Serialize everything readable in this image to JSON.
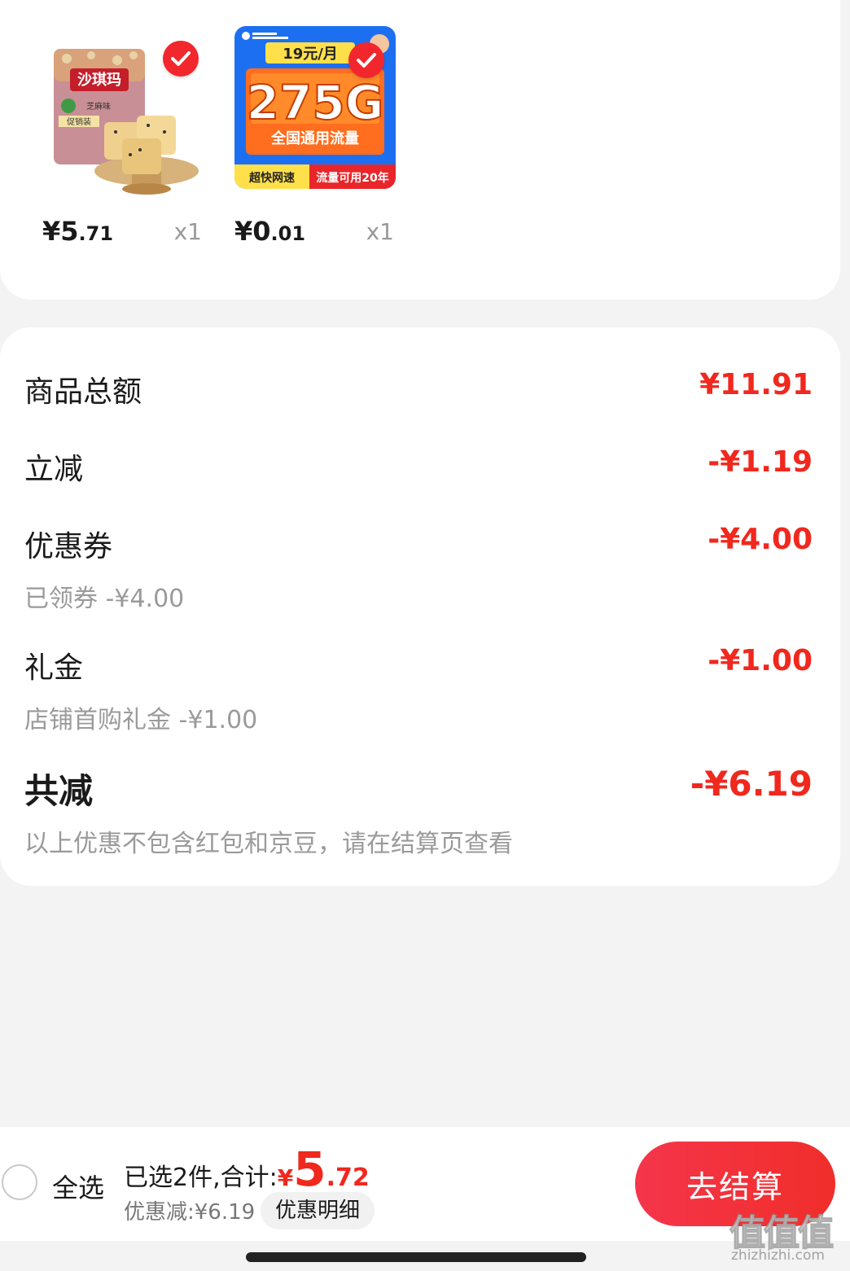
{
  "products": [
    {
      "name": "沙琪玛",
      "package_text": {
        "brand": "沙琪玛",
        "flavor": "芝麻味",
        "promo": "促销装"
      },
      "price_main": "¥5",
      "price_cents": ".71",
      "quantity": "x1",
      "selected": true
    },
    {
      "name": "275G",
      "package_text": {
        "top": "19元/月",
        "main": "275G",
        "sub": "全国通用流量",
        "left_tag": "超快网速",
        "right_tag": "流量可用20年"
      },
      "price_main": "¥0",
      "price_cents": ".01",
      "quantity": "x1",
      "selected": true
    }
  ],
  "summary": {
    "goods_total_label": "商品总额",
    "goods_total_value": "¥11.91",
    "instant_cut_label": "立减",
    "instant_cut_value": "-¥1.19",
    "coupon_label": "优惠券",
    "coupon_value": "-¥4.00",
    "coupon_sub": "已领券 -¥4.00",
    "gift_label": "礼金",
    "gift_value": "-¥1.00",
    "gift_sub": "店铺首购礼金 -¥1.00",
    "total_cut_label": "共减",
    "total_cut_value": "-¥6.19",
    "note": "以上优惠不包含红包和京豆，请在结算页查看"
  },
  "bottom_bar": {
    "select_all_label": "全选",
    "selected_prefix": "已选2件,合计:",
    "total_yen": "¥",
    "total_int": "5",
    "total_dec": ".72",
    "discount_text": "优惠减:¥6.19",
    "detail_label": "优惠明细",
    "checkout_label": "去结算"
  },
  "watermark": {
    "big": "值值值",
    "small": "zhizhizhi.com"
  },
  "colors": {
    "accent": "#f0281e",
    "checkout": "#f5354b",
    "background": "#f3f3f3"
  }
}
